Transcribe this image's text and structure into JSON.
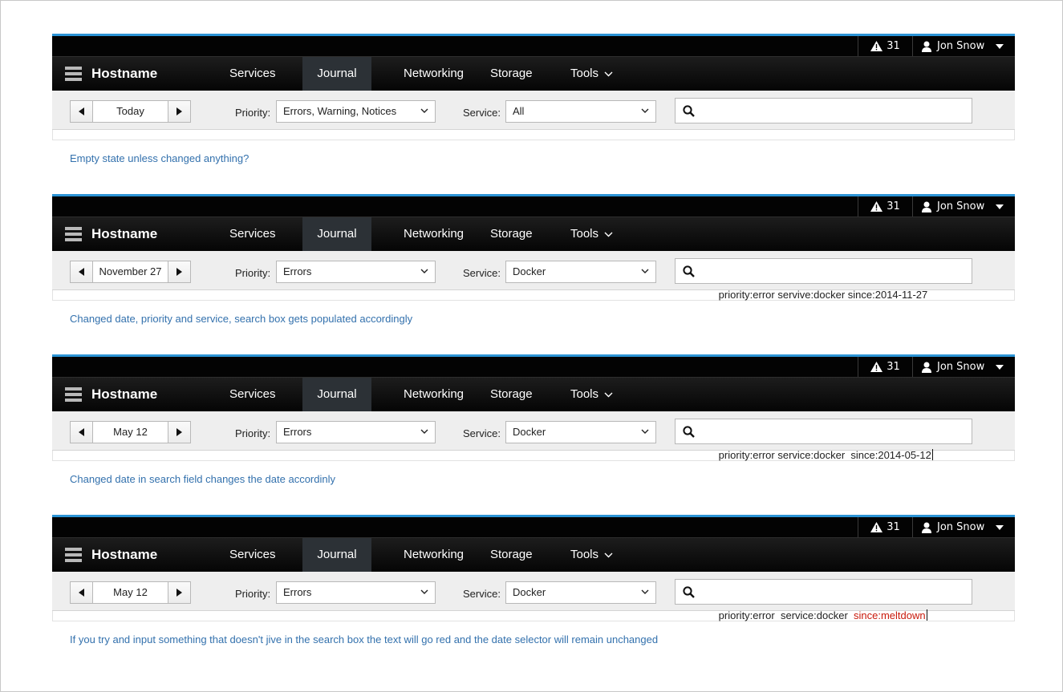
{
  "topbar": {
    "alert_count": "31",
    "user_name": "Jon Snow"
  },
  "nav": {
    "hostname": "Hostname",
    "items": [
      "Services",
      "Journal",
      "Networking",
      "Storage"
    ],
    "tools_label": "Tools",
    "active": "Journal"
  },
  "filters": {
    "priority_label": "Priority:",
    "service_label": "Service:"
  },
  "panels": [
    {
      "date": "Today",
      "priority": "Errors, Warning, Notices",
      "service": "All",
      "search": "",
      "caption": "Empty state unless changed anything?"
    },
    {
      "date": "November 27",
      "priority": "Errors",
      "service": "Docker",
      "search": "priority:error servive:docker since:2014-11-27",
      "caption": "Changed date, priority and service, search box gets populated accordingly"
    },
    {
      "date": "May 12",
      "priority": "Errors",
      "service": "Docker",
      "search": "priority:error service:docker  since:2014-05-12",
      "caption": "Changed date in search field changes the date accordinly"
    },
    {
      "date": "May 12",
      "priority": "Errors",
      "service": "Docker",
      "search": "priority:error  service:docker  ",
      "search_invalid": "since:meltdown",
      "caption": "If you try and input something that doesn't jive in the search box the text will go red and the date selector will remain unchanged"
    }
  ],
  "colors": {
    "accent": "#2c94d6",
    "caption": "#3371ad",
    "error_text": "#c9190b",
    "active_tab": "#2c3136"
  }
}
